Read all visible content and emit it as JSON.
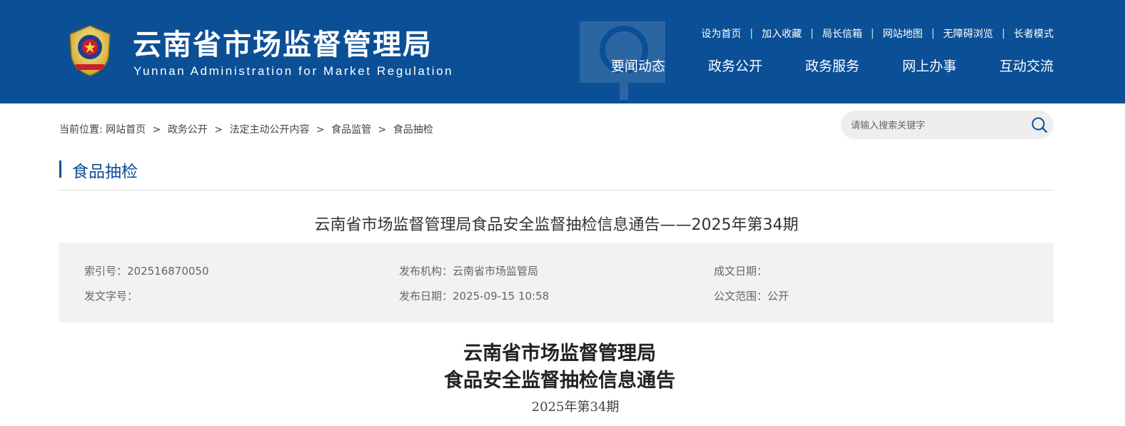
{
  "header": {
    "site_title": "云南省市场监督管理局",
    "site_subtitle": "Yunnan Administration for Market Regulation",
    "top_links": [
      "设为首页",
      "加入收藏",
      "局长信箱",
      "网站地图",
      "无障碍浏览",
      "长者模式"
    ],
    "nav": [
      "要闻动态",
      "政务公开",
      "政务服务",
      "网上办事",
      "互动交流"
    ],
    "colors": {
      "primary": "#0b4f96",
      "text_white": "#ffffff"
    }
  },
  "breadcrumb": {
    "prefix": "当前位置:",
    "items": [
      "网站首页",
      "政务公开",
      "法定主动公开内容",
      "食品监管",
      "食品抽检"
    ],
    "separator": ">"
  },
  "search": {
    "placeholder": "请输入搜索关键字",
    "icon": "search-icon"
  },
  "section": {
    "title": "食品抽检"
  },
  "article": {
    "title": "云南省市场监督管理局食品安全监督抽检信息通告——2025年第34期",
    "meta": {
      "index_no": "索引号：202516870050",
      "publisher": "发布机构：云南省市场监管局",
      "created_date": "成文日期：",
      "doc_no": "发文字号：",
      "publish_date": "发布日期：2025-09-15 10:58",
      "scope": "公文范围：公开"
    },
    "content_title_line1": "云南省市场监督管理局",
    "content_title_line2": "食品安全监督抽检信息通告",
    "content_issue": "2025年第34期"
  }
}
